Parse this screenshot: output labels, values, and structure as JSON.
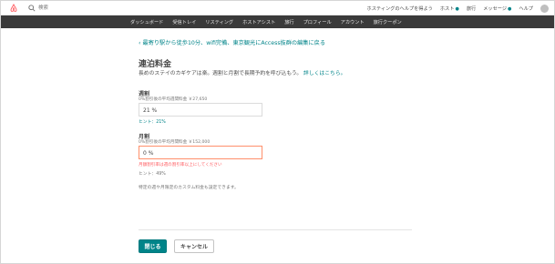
{
  "topbar": {
    "logo_icon": "airbnb-logo",
    "search_placeholder": "検索",
    "links": [
      "ホスティングのヘルプを得よう",
      "ホスト",
      "旅行",
      "メッセージ",
      "ヘルプ"
    ]
  },
  "nav": {
    "items": [
      "ダッシュボード",
      "受信トレイ",
      "リスティング",
      "ホストアシスト",
      "旅行",
      "プロフィール",
      "アカウント",
      "旅行クーポン"
    ]
  },
  "main": {
    "back_link": "最寄り駅から徒歩10分、wifi完備、東京観光にAccess抜群の編集に戻る",
    "title": "連泊料金",
    "desc_text": "長めのステイのカギケアは楽。週割と月割で長期予約を呼び込もう。",
    "desc_link": "詳しくはこちら。",
    "weekly": {
      "label": "週割",
      "sub": "0%割引後の平均週間料金 ￥27,650",
      "value": "21 %",
      "hint": "ヒント：21%"
    },
    "monthly": {
      "label": "月割",
      "sub": "0%割引後の平均月間料金 ￥152,000",
      "value": "0 %",
      "error": "月額割引率は週の割引率以上にしてください",
      "hint": "ヒント：49%"
    },
    "note": "特定の週や月限定のカスタム料金も設定できます。"
  },
  "footer": {
    "close_label": "閉じる",
    "cancel_label": "キャンセル"
  },
  "colors": {
    "accent": "#008489",
    "error": "#ff5a5f",
    "nav_bg": "#3a3a3a"
  }
}
